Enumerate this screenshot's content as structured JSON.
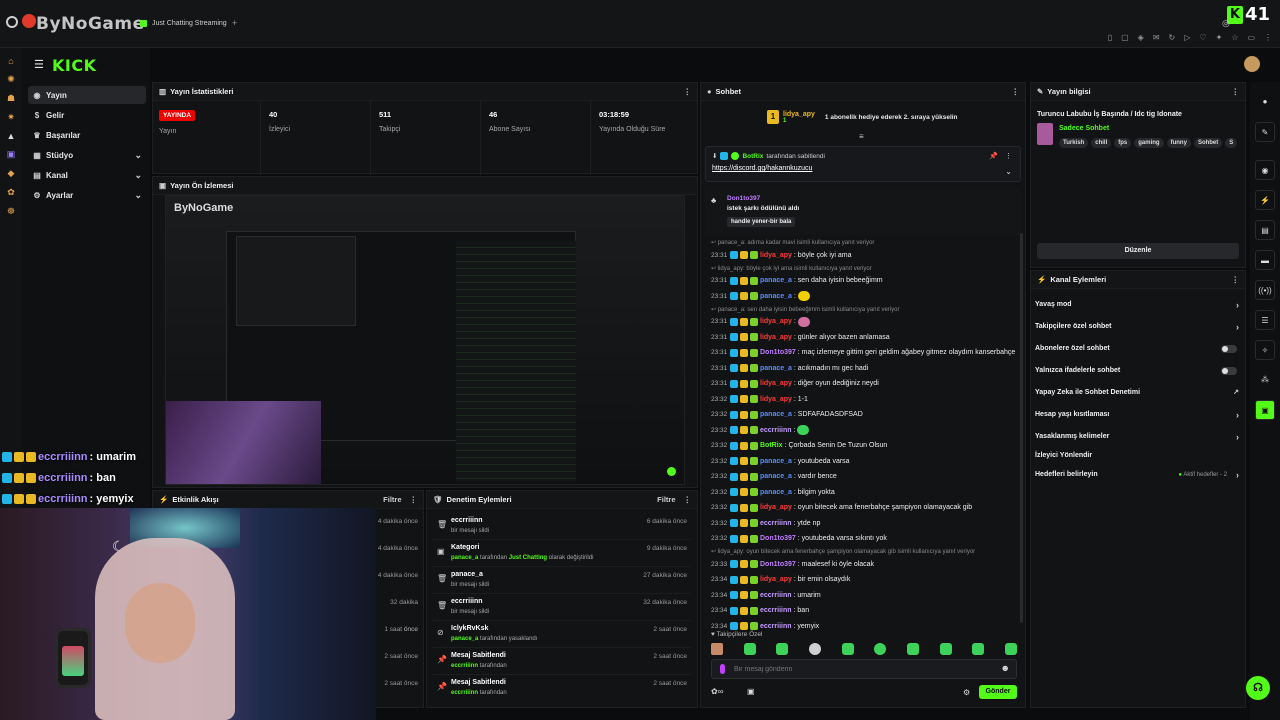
{
  "browser": {
    "watermark": "ByNoGame",
    "tabs": [
      {
        "label": "Just Chatting Streaming"
      }
    ],
    "new_tab": "+",
    "kick_score": "41"
  },
  "sidenav": {
    "logo": "KICK",
    "items": [
      {
        "label": "Yayın"
      },
      {
        "label": "Gelir"
      },
      {
        "label": "Başarılar"
      },
      {
        "label": "Stüdyo"
      },
      {
        "label": "Kanal"
      },
      {
        "label": "Ayarlar"
      }
    ]
  },
  "stats": {
    "title": "Yayın İstatistikleri",
    "live": "YAYINDA",
    "items": [
      {
        "label": "Yayın",
        "value": ""
      },
      {
        "label": "İzleyici",
        "value": "40"
      },
      {
        "label": "Takipçi",
        "value": "511"
      },
      {
        "label": "Abone Sayısı",
        "value": "46"
      },
      {
        "label": "Yayında Olduğu Süre",
        "value": "03:18:59"
      }
    ]
  },
  "preview": {
    "title": "Yayın Ön İzlemesi",
    "inner_title": "ByNoGame"
  },
  "overlay_chat": [
    {
      "name": "eccrriiinn",
      "message": ": umarim"
    },
    {
      "name": "eccrriiinn",
      "message": ": ban"
    },
    {
      "name": "eccrriiinn",
      "message": ": yemyix"
    }
  ],
  "activity": {
    "title": "Etkinlik Akışı",
    "filter": "Filtre",
    "times": [
      "4 dakika önce",
      "4 dakika önce",
      "4 dakika önce",
      "32 dakika önce",
      "1 saat önce",
      "2 saat önce",
      "2 saat önce"
    ]
  },
  "moderation": {
    "title": "Denetim Eylemleri",
    "filter": "Filtre",
    "rows": [
      {
        "title": "eccrriiinn",
        "desc": "bir mesajı sildi",
        "time": "6 dakika önce",
        "icon": "trash-icon"
      },
      {
        "title": "Kategori",
        "desc_who": "panace_a",
        "desc": "tarafından",
        "desc_hl": "Just Chatting",
        "desc2": "olarak değiştirildi",
        "time": "9 dakika önce",
        "icon": "category-icon"
      },
      {
        "title": "panace_a",
        "desc": "bir mesajı sildi",
        "time": "27 dakika önce",
        "icon": "trash-icon"
      },
      {
        "title": "eccrriiinn",
        "desc": "bir mesajı sildi",
        "time": "32 dakika önce",
        "icon": "trash-icon"
      },
      {
        "title": "IclykRvKsk",
        "desc_who": "panace_a",
        "desc": "tarafından yasaklandı",
        "time": "2 saat önce",
        "icon": "ban-icon"
      },
      {
        "title": "Mesaj Sabitlendi",
        "desc_who": "eccrriiinn",
        "desc": "tarafından",
        "time": "2 saat önce",
        "icon": "pin-icon"
      },
      {
        "title": "Mesaj Sabitlendi",
        "desc_who": "eccrriiinn",
        "desc": "tarafından",
        "time": "2 saat önce",
        "icon": "pin-icon"
      }
    ]
  },
  "chat": {
    "title": "Sohbet",
    "gift_user": "lidya_apy",
    "gift_count": "1",
    "gift_text": "1 abonelik hediye ederek 2. sıraya yükselin",
    "pinned_by": "BotRix",
    "pinned_label": "tarafından sabitlendi",
    "pinned_link": "https://discord.gg/hakannkuzucu",
    "reward_user": "Don1to397",
    "reward_title": "istek şarkı ödülünü aldı",
    "reward_text": "handle yener-bir bala",
    "lines": [
      {
        "type": "reply",
        "text": "panace_a: adıma kadar mavi isimli kullanıcıya yanıt veriyor"
      },
      {
        "ts": "23:31",
        "name": "lidya_apy",
        "color": "red",
        "msg": ": böyle çok iyi ama"
      },
      {
        "type": "reply",
        "text": "lidya_apy: böyle çok iyi ama isimli kullanıcıya yanıt veriyor"
      },
      {
        "ts": "23:31",
        "name": "panace_a",
        "color": "blue",
        "msg": ": sen daha iyisin bebeeğimm"
      },
      {
        "ts": "23:31",
        "name": "panace_a",
        "color": "blue",
        "msg": ":",
        "emoji": "y"
      },
      {
        "type": "reply",
        "text": "panace_a: sen daha iyisin bebeeğimm isimli kullanıcıya yanıt veriyor"
      },
      {
        "ts": "23:31",
        "name": "lidya_apy",
        "color": "red",
        "msg": ":",
        "emoji": "p"
      },
      {
        "ts": "23:31",
        "name": "lidya_apy",
        "color": "red",
        "msg": ": günler alıyor bazen anlamasa"
      },
      {
        "ts": "23:31",
        "name": "Don1to397",
        "color": "purple",
        "msg": ": maç izlemeye gittim geri geldim ağabey gitmez olaydım kanserbahçe"
      },
      {
        "ts": "23:31",
        "name": "panace_a",
        "color": "blue",
        "msg": ": acıkmadın mı gec hadi"
      },
      {
        "ts": "23:31",
        "name": "lidya_apy",
        "color": "red",
        "msg": ": diğer oyun dediğiniz neydi"
      },
      {
        "ts": "23:32",
        "name": "lidya_apy",
        "color": "red",
        "msg": ": 1-1"
      },
      {
        "ts": "23:32",
        "name": "panace_a",
        "color": "blue",
        "msg": ": SDFAFADASDFSAD"
      },
      {
        "ts": "23:32",
        "name": "eccrriiinn",
        "color": "violet",
        "msg": ":",
        "emoji": "g"
      },
      {
        "ts": "23:32",
        "name": "BotRix",
        "color": "green",
        "msg": ": Çorbada Senin De Tuzun Olsun"
      },
      {
        "ts": "23:32",
        "name": "panace_a",
        "color": "blue",
        "msg": ": youtubeda varsa"
      },
      {
        "ts": "23:32",
        "name": "panace_a",
        "color": "blue",
        "msg": ": vardır bence"
      },
      {
        "ts": "23:32",
        "name": "panace_a",
        "color": "blue",
        "msg": ": bilgim yokta"
      },
      {
        "ts": "23:32",
        "name": "lidya_apy",
        "color": "red",
        "msg": ": oyun bitecek ama fenerbahçe şampiyon olamayacak gib"
      },
      {
        "ts": "23:32",
        "name": "eccrriiinn",
        "color": "violet",
        "msg": ": ytde np"
      },
      {
        "ts": "23:32",
        "name": "Don1to397",
        "color": "purple",
        "msg": ": youtubeda varsa sıkıntı yok"
      },
      {
        "type": "reply",
        "text": "lidya_apy: oyun bitecek ama fenerbahçe şampiyon olamayacak gib isimli kullanıcıya yanıt veriyor"
      },
      {
        "ts": "23:33",
        "name": "Don1to397",
        "color": "purple",
        "msg": ": maalesef ki öyle olacak"
      },
      {
        "ts": "23:34",
        "name": "lidya_apy",
        "color": "red",
        "msg": ": bir emin olsaydık"
      },
      {
        "ts": "23:34",
        "name": "eccrriiinn",
        "color": "violet",
        "msg": ": umarim"
      },
      {
        "ts": "23:34",
        "name": "eccrriiinn",
        "color": "violet",
        "msg": ": ban"
      },
      {
        "ts": "23:34",
        "name": "eccrriiinn",
        "color": "violet",
        "msg": ": yemyix"
      }
    ],
    "followers_label": "Takipçilere Özel",
    "input_placeholder": "Bir mesaj gönderin",
    "send": "Gönder"
  },
  "info": {
    "title": "Yayın bilgisi",
    "stream_title": "Turuncu Labubu İş Başında / Idc tig Idonate",
    "category": "Sadece Sohbet",
    "tags": [
      "Turkish",
      "chill",
      "fps",
      "gaming",
      "funny",
      "Sohbet",
      "S"
    ],
    "edit": "Düzenle"
  },
  "actions": {
    "title": "Kanal Eylemleri",
    "items": [
      {
        "label": "Yavaş mod",
        "kind": "chevron"
      },
      {
        "label": "Takipçilere özel sohbet",
        "kind": "chevron"
      },
      {
        "label": "Abonelere özel sohbet",
        "kind": "toggle"
      },
      {
        "label": "Yalnızca ifadelerle sohbet",
        "kind": "toggle"
      },
      {
        "label": "Yapay Zeka ile Sohbet Denetimi",
        "kind": "external"
      },
      {
        "label": "Hesap yaşı kısıtlaması",
        "kind": "chevron"
      },
      {
        "label": "Yasaklanmış kelimeler",
        "kind": "chevron"
      },
      {
        "label": "İzleyici Yönlendir",
        "kind": "none"
      },
      {
        "label": "Hedefleri belirleyin",
        "kind": "goal",
        "extra": "Aktif hedefler - 2"
      }
    ]
  },
  "colors": {
    "accent": "#53fc18",
    "live": "#eb0400",
    "panel": "#121314"
  }
}
